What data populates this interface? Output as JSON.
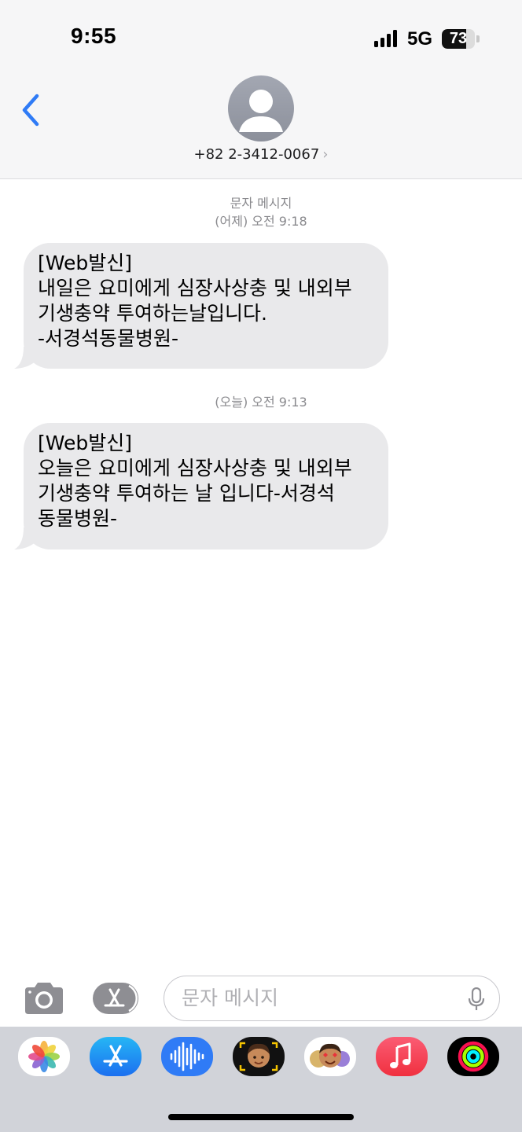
{
  "status_bar": {
    "time": "9:55",
    "network": "5G",
    "battery_percent": "73",
    "battery_level": 0.73
  },
  "header": {
    "contact_number": "+82 2-3412-0067",
    "chevron": "›",
    "back_icon": "chevron-left-icon",
    "avatar_icon": "person-silhouette-icon"
  },
  "thread": {
    "service_label": "문자 메시지",
    "messages": [
      {
        "timestamp": "(어제) 오전 9:18",
        "lines": [
          "[Web발신]",
          "내일은 요미에게 심장사상충 및 내외부",
          "기생충약 투여하는날입니다.",
          "-서경석동물병원-"
        ]
      },
      {
        "timestamp": "(오늘) 오전 9:13",
        "lines": [
          "[Web발신]",
          "오늘은 요미에게 심장사상충 및 내외부",
          "기생충약 투여하는 날 입니다-서경석",
          "동물병원-"
        ]
      }
    ]
  },
  "compose": {
    "placeholder": "문자 메시지",
    "camera_icon": "camera-icon",
    "apps_icon": "app-store-icon",
    "mic_icon": "microphone-icon"
  },
  "app_drawer": {
    "apps": [
      "photos-icon",
      "app-store-icon",
      "audio-message-icon",
      "memoji-icon",
      "animoji-stickers-icon",
      "music-icon",
      "activity-icon"
    ]
  },
  "colors": {
    "accent_blue": "#2f7bf6",
    "bubble_gray": "#e9e9eb",
    "meta_gray": "#8a8a8e",
    "header_bg": "#f6f6f7",
    "drawer_bg": "#d1d3d9"
  }
}
